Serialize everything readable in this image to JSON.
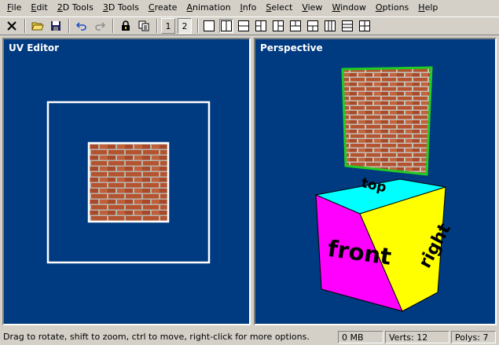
{
  "menu": [
    "File",
    "Edit",
    "2D Tools",
    "3D Tools",
    "Create",
    "Animation",
    "Info",
    "Select",
    "View",
    "Window",
    "Options",
    "Help"
  ],
  "toolbar": {
    "icons": [
      "delete-icon",
      "open-folder-icon",
      "save-icon",
      "undo-icon",
      "redo-icon",
      "lock-icon",
      "copy-icon"
    ],
    "view_numbers": [
      "1",
      "2"
    ],
    "layouts": [
      "layout-single",
      "layout-two-vertical",
      "layout-two-horizontal",
      "layout-three-left",
      "layout-three-right",
      "layout-three-top",
      "layout-three-bottom",
      "layout-three-columns",
      "layout-three-rows",
      "layout-four"
    ]
  },
  "panes": {
    "uv_editor": {
      "title": "UV Editor"
    },
    "perspective": {
      "title": "Perspective"
    }
  },
  "cube": {
    "front_label": "front",
    "right_label": "right",
    "top_label": "top",
    "front_color": "#ff00ff",
    "right_color": "#ffff00",
    "top_color": "#00ffff"
  },
  "selection_color": "#22cc22",
  "status": {
    "message": "Drag to rotate, shift to zoom, ctrl to move, right-click for more options.",
    "memory": "0 MB",
    "verts": "Verts: 12",
    "polys": "Polys: 7"
  }
}
